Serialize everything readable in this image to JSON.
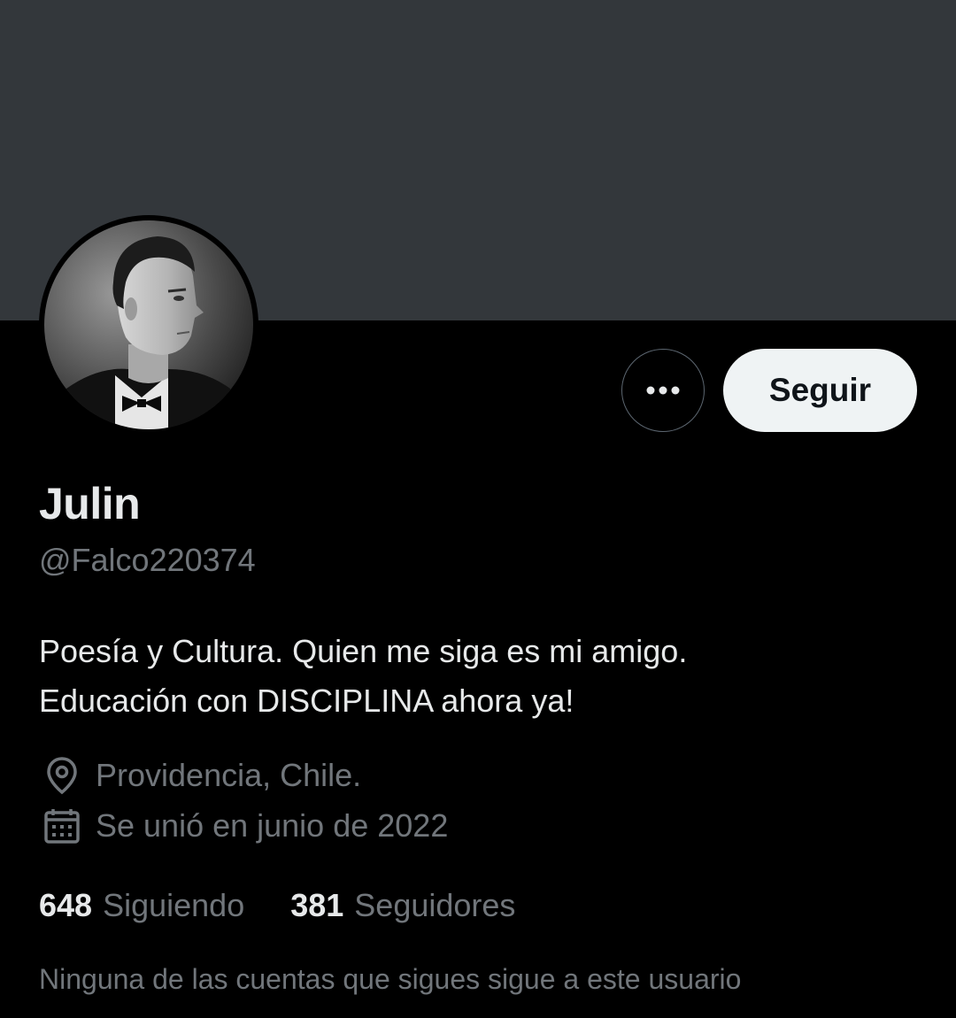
{
  "profile": {
    "display_name": "Julin",
    "handle": "@Falco220374",
    "bio_line1": "Poesía y Cultura. Quien me siga es mi amigo.",
    "bio_line2": "Educación con DISCIPLINA ahora ya!",
    "location": "Providencia, Chile.",
    "joined": "Se unió en junio de 2022"
  },
  "actions": {
    "follow_label": "Seguir",
    "more_icon": "ellipsis-icon"
  },
  "stats": {
    "following_count": "648",
    "following_label": "Siguiendo",
    "followers_count": "381",
    "followers_label": "Seguidores"
  },
  "note": {
    "mutuals_text": "Ninguna de las cuentas que sigues sigue a este usuario"
  },
  "icons": {
    "location": "map-pin-icon",
    "joined": "calendar-icon"
  },
  "colors": {
    "background": "#000000",
    "banner": "#33373b",
    "primary_text": "#e7e9ea",
    "secondary_text": "#71767b",
    "follow_button_bg": "#eff3f4"
  }
}
